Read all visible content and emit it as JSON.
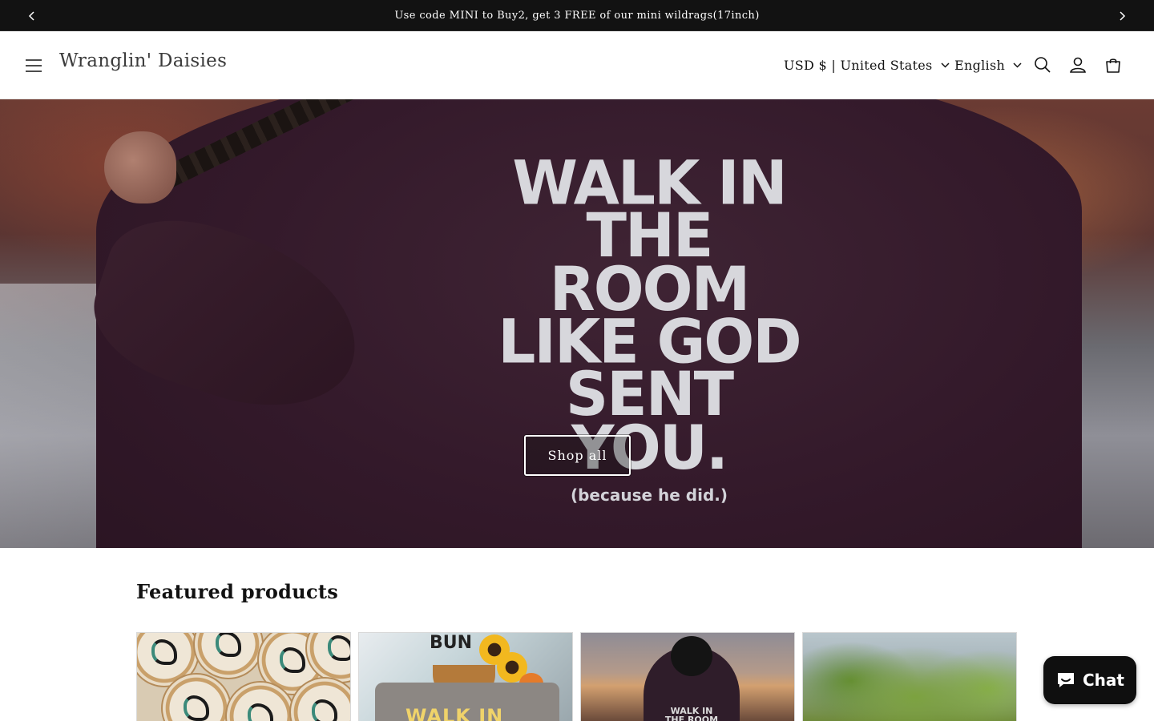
{
  "announcement": {
    "text": "Use code MINI to Buy2, get 3 FREE of our mini wildrags(17inch)",
    "prev_icon": "chevron-left-icon",
    "next_icon": "chevron-right-icon"
  },
  "header": {
    "menu_icon": "hamburger-menu-icon",
    "brand": "Wranglin' Daisies",
    "country_selector": "USD $ | United States",
    "language_selector": "English",
    "search_icon": "search-icon",
    "account_icon": "account-icon",
    "cart_icon": "cart-icon"
  },
  "hero": {
    "sweater_lines": [
      "WALK IN",
      "THE ROOM",
      "LIKE GOD",
      "SENT YOU."
    ],
    "sweater_subline": "(because he did.)",
    "button_label": "Shop all"
  },
  "featured": {
    "title": "Featured products",
    "card2_shirt_text": "WALK IN",
    "card2_top_text": "BUN",
    "card3_shirt_text": "WALK IN THE ROOM"
  },
  "chat": {
    "label": "Chat",
    "icon": "chat-bubble-icon"
  },
  "colors": {
    "announcement_bg": "#121212",
    "chat_bg": "#0f0f0f",
    "text": "#121212"
  }
}
